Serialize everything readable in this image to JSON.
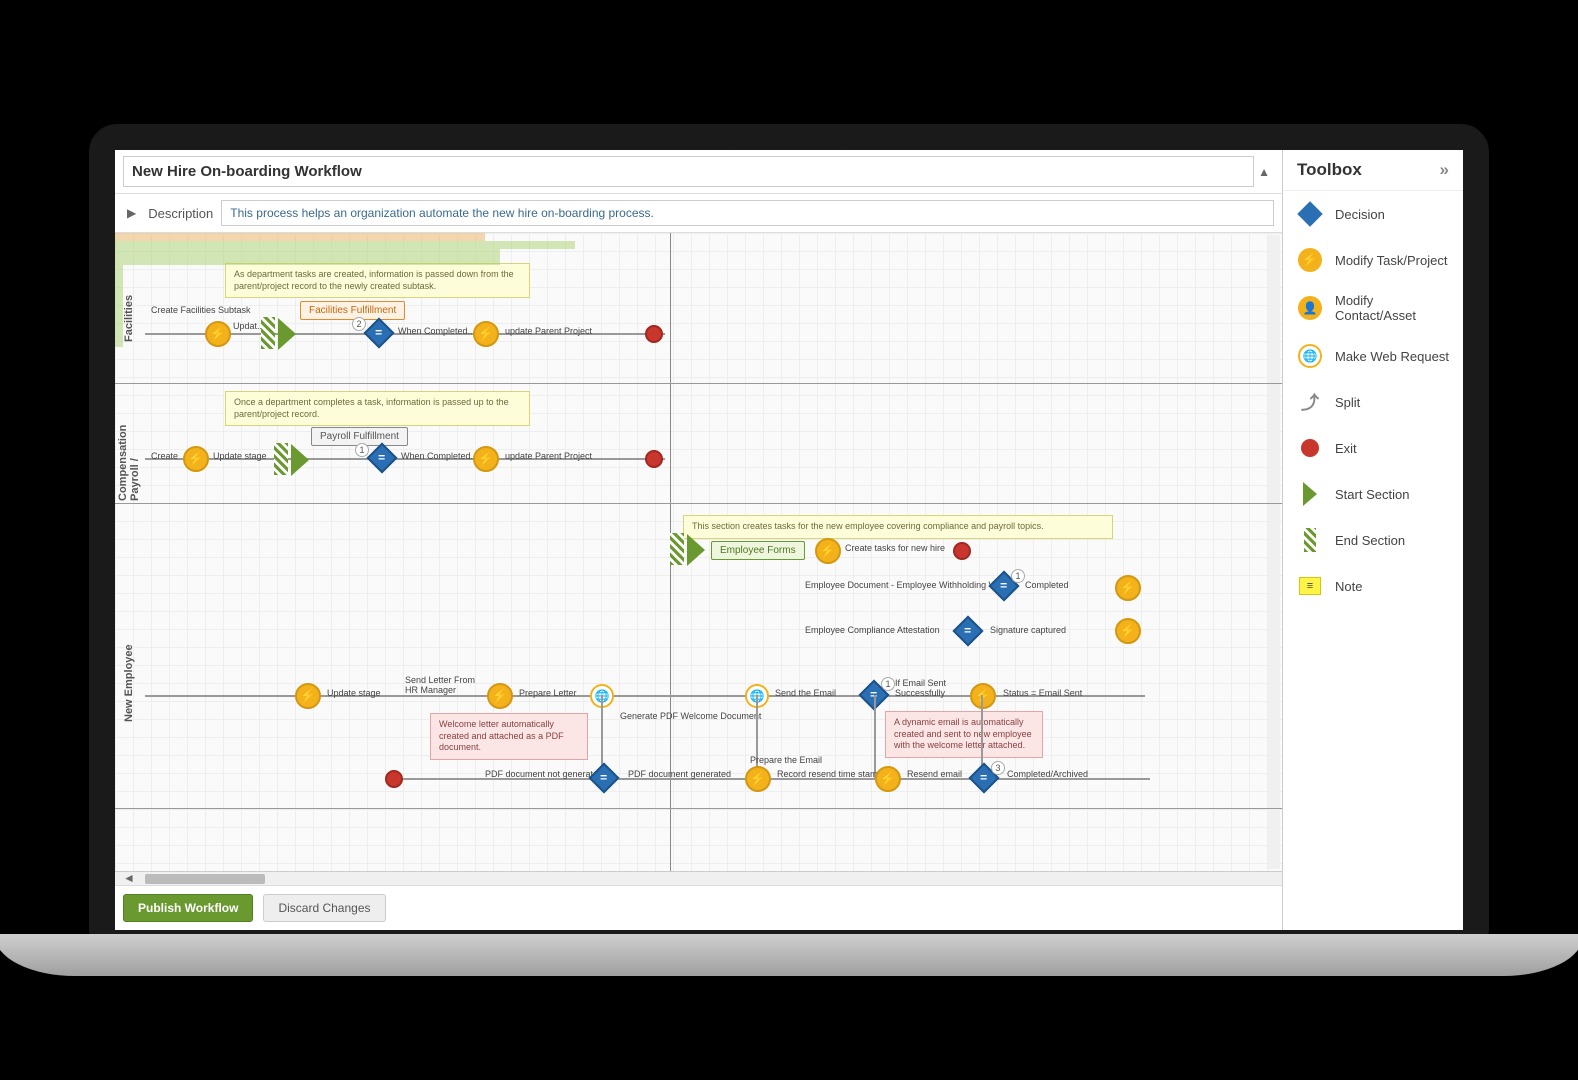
{
  "title": "New Hire On-boarding Workflow",
  "description_label": "Description",
  "description": "This process helps an organization automate the new hire on-boarding process.",
  "lanes": {
    "facilities": "Facilities",
    "payroll": "Payroll / Compensation",
    "newemp": "New Employee"
  },
  "notes": {
    "fac": "As department tasks are created, information is passed down from the parent/project record to the newly created subtask.",
    "pay": "Once a department completes a task, information is passed up to the parent/project record.",
    "emp": "This section creates tasks for the new employee covering compliance and payroll topics.",
    "welcome": "Welcome letter automatically created and attached as a PDF document.",
    "email": "A dynamic email is automatically created and sent to new employee with the welcome letter attached."
  },
  "sections": {
    "facilities": "Facilities Fulfillment",
    "payroll": "Payroll Fulfillment",
    "empforms": "Employee Forms"
  },
  "labels": {
    "create_fac": "Create Facilities Subtask",
    "updat": "Updat...",
    "when_completed": "When Completed...",
    "update_parent": "update Parent Project",
    "create": "Create",
    "update_stage": "Update stage",
    "create_tasks": "Create tasks for new hire",
    "emp_doc": "Employee Document - Employee Withholding W4",
    "completed": "Completed",
    "emp_compliance": "Employee Compliance Attestation",
    "sig_captured": "Signature captured",
    "send_letter": "Send Letter From HR Manager",
    "prepare_letter": "Prepare Letter",
    "gen_pdf": "Generate PDF Welcome Document",
    "send_email": "Send the Email",
    "if_email": "If Email Sent Successfully",
    "status_sent": "Status = Email Sent",
    "pdf_not": "PDF document not generated",
    "pdf_gen": "PDF document generated",
    "prep_email": "Prepare the Email",
    "record_resend": "Record resend time stamp",
    "resend": "Resend email",
    "comp_arch": "Completed/Archived"
  },
  "toolbox": {
    "title": "Toolbox",
    "items": {
      "decision": "Decision",
      "modify_task": "Modify Task/Project",
      "modify_contact": "Modify Contact/Asset",
      "web": "Make Web Request",
      "split": "Split",
      "exit": "Exit",
      "start": "Start Section",
      "end": "End Section",
      "note": "Note"
    }
  },
  "buttons": {
    "publish": "Publish Workflow",
    "discard": "Discard Changes"
  }
}
